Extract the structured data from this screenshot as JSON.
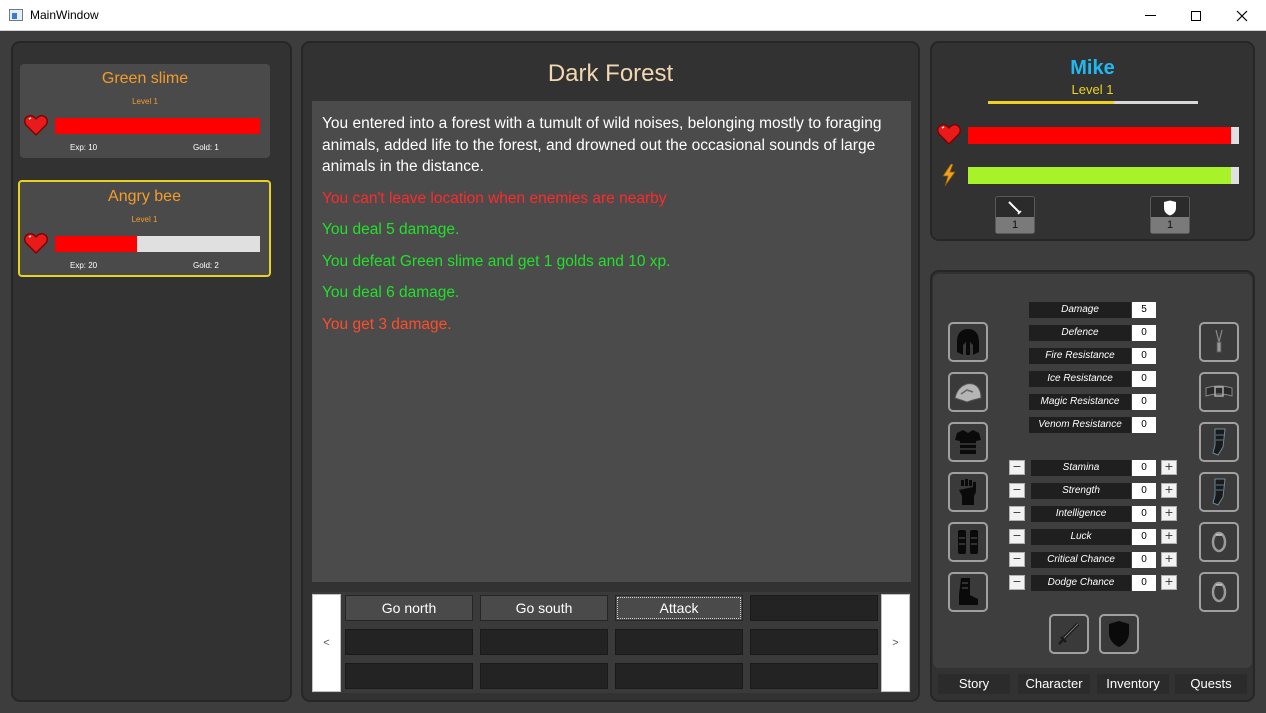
{
  "window": {
    "title": "MainWindow"
  },
  "enemies": [
    {
      "name": "Green slime",
      "level": "Level 1",
      "exp": "Exp: 10",
      "gold": "Gold: 1",
      "hp_fraction": 1.0,
      "selected": false
    },
    {
      "name": "Angry bee",
      "level": "Level 1",
      "exp": "Exp: 20",
      "gold": "Gold: 2",
      "hp_fraction": 0.4,
      "selected": true
    }
  ],
  "location": {
    "title": "Dark Forest",
    "log": [
      {
        "type": "story",
        "text": "You entered into a forest with a tumult of wild noises, belonging mostly to foraging animals, added life to the forest, and drowned out the occasional sounds of large animals in the distance."
      },
      {
        "type": "warn",
        "text": "You can't leave location when enemies are nearby"
      },
      {
        "type": "good",
        "text": "You deal 5 damage."
      },
      {
        "type": "good",
        "text": "You defeat Green slime and get 1 golds and 10 xp."
      },
      {
        "type": "good",
        "text": "You deal 6 damage."
      },
      {
        "type": "bad",
        "text": "You get 3 damage."
      }
    ]
  },
  "actions": {
    "prev_label": "<",
    "next_label": ">",
    "buttons": [
      "Go north",
      "Go south",
      "Attack",
      "",
      "",
      "",
      "",
      "",
      "",
      "",
      "",
      ""
    ]
  },
  "player": {
    "name": "Mike",
    "level": "Level 1",
    "xp_fraction": 0.6,
    "hp_fraction": 0.97,
    "energy_fraction": 0.97,
    "sword_count": "1",
    "shield_count": "1"
  },
  "stats": [
    {
      "label": "Damage",
      "value": "5"
    },
    {
      "label": "Defence",
      "value": "0"
    },
    {
      "label": "Fire Resistance",
      "value": "0"
    },
    {
      "label": "Ice Resistance",
      "value": "0"
    },
    {
      "label": "Magic Resistance",
      "value": "0"
    },
    {
      "label": "Venom Resistance",
      "value": "0"
    }
  ],
  "attributes": [
    {
      "label": "Stamina",
      "value": "0"
    },
    {
      "label": "Strength",
      "value": "0"
    },
    {
      "label": "Intelligence",
      "value": "0"
    },
    {
      "label": "Luck",
      "value": "0"
    },
    {
      "label": "Critical Chance",
      "value": "0"
    },
    {
      "label": "Dodge Chance",
      "value": "0"
    }
  ],
  "attr_controls": {
    "minus": "−",
    "plus": "+"
  },
  "equipment_left": [
    "helmet-icon",
    "shoulder-icon",
    "chest-armor-icon",
    "gauntlet-icon",
    "leg-armor-icon",
    "boot-icon"
  ],
  "equipment_right": [
    "amulet-icon",
    "belt-icon",
    "bracer-icon",
    "bracer-icon",
    "ring-icon",
    "ring-icon"
  ],
  "nav": [
    "Story",
    "Character",
    "Inventory",
    "Quests"
  ],
  "colors": {
    "hp": "#ff0000",
    "energy": "#a8f22a",
    "xp": "#f0d21e",
    "enemy_name": "#f39c2b",
    "player_name": "#21b8f0",
    "selection": "#e7d21e"
  }
}
